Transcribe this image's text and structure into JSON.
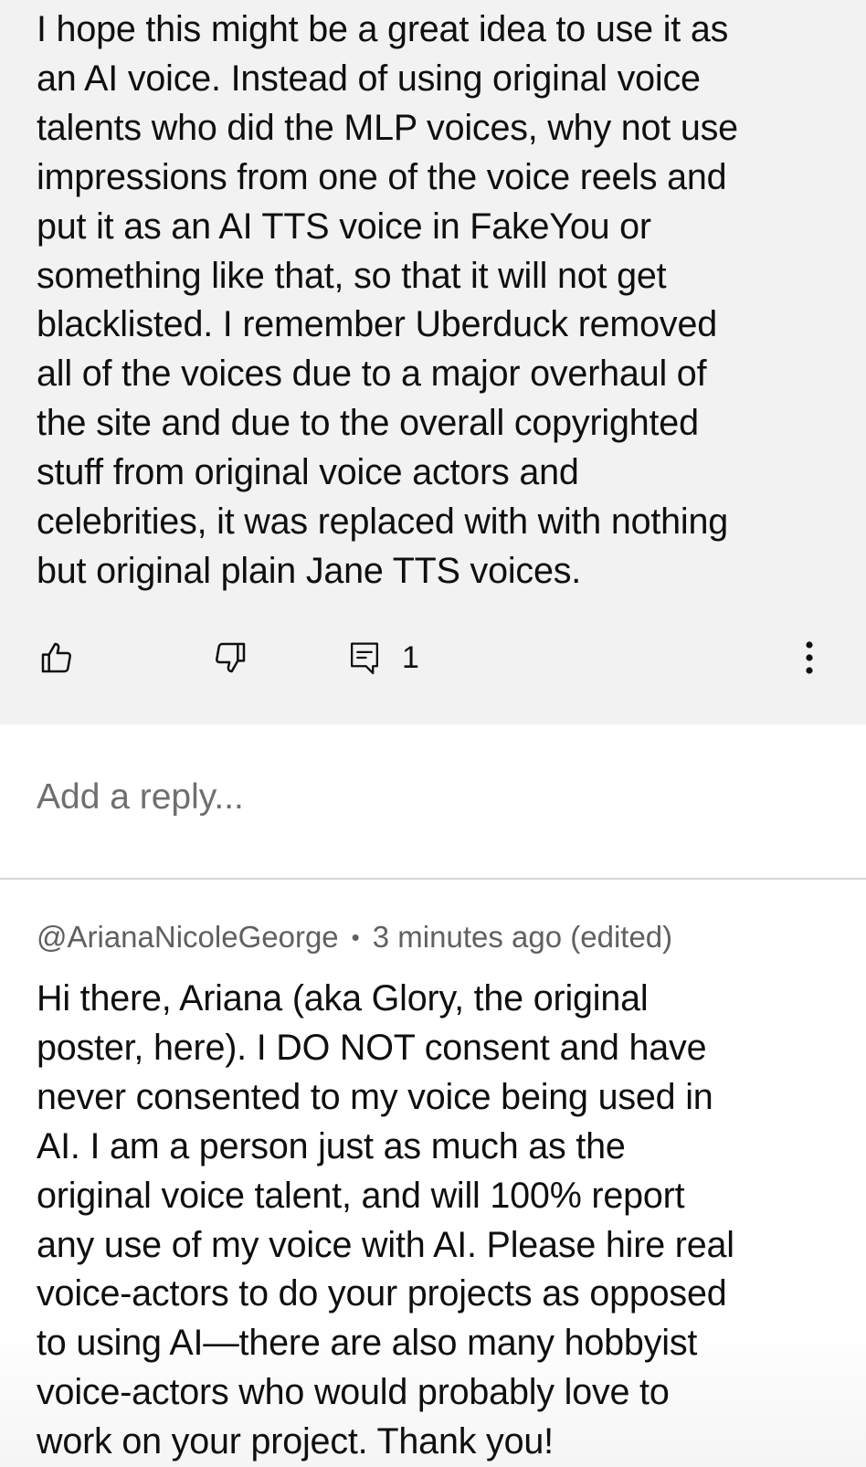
{
  "comment": {
    "text": "I hope this might be a great idea to use it as\nan AI voice. Instead of using original voice\ntalents who did the MLP voices, why not use\nimpressions from one of the voice reels and\nput it as an AI TTS voice in FakeYou or\nsomething like that, so that it will not get\nblacklisted. I remember Uberduck removed\nall of the voices due to a major overhaul of\nthe site and due to the overall copyrighted\nstuff from original voice actors and\ncelebrities, it was replaced with with nothing\nbut original plain Jane TTS voices.",
    "actions": {
      "like_icon": "thumbs-up-icon",
      "dislike_icon": "thumbs-down-icon",
      "replies_icon": "comment-icon",
      "reply_count": "1",
      "more_icon": "more-vertical-icon"
    }
  },
  "reply_input": {
    "placeholder": "Add a reply..."
  },
  "reply": {
    "author": "@ArianaNicoleGeorge",
    "separator": "•",
    "timestamp": "3 minutes ago (edited)",
    "text": "Hi there, Ariana (aka Glory, the original\nposter, here).  I DO NOT consent and have\nnever consented to my voice being used in\nAI.  I am a person just as much as the\noriginal voice talent, and will 100% report\nany use of my voice with AI. Please hire real\nvoice-actors to do your projects as opposed\nto using AI—there are also many hobbyist\nvoice-actors who would probably love to\nwork on your project. Thank you!"
  },
  "colors": {
    "comment_background": "#f2f2f2",
    "text": "#0f0f0f",
    "meta_text": "#606060",
    "placeholder_text": "#6f6f6f",
    "divider": "#d7d7d7"
  }
}
